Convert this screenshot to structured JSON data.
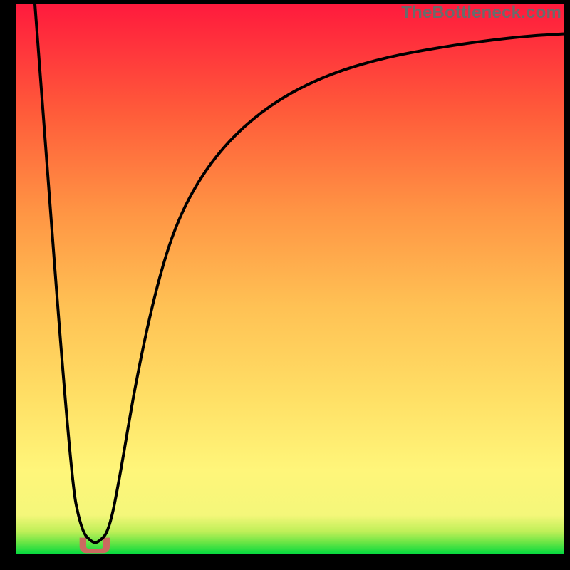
{
  "watermark": "TheBottleneck.com",
  "chart_data": {
    "type": "line",
    "title": "",
    "xlabel": "",
    "ylabel": "",
    "xlim": [
      0,
      100
    ],
    "ylim": [
      0,
      100
    ],
    "grid": false,
    "legend": false,
    "background_gradient_stops": [
      {
        "pct": 0,
        "color": "#08da3f"
      },
      {
        "pct": 2,
        "color": "#69e545"
      },
      {
        "pct": 4,
        "color": "#beef58"
      },
      {
        "pct": 7,
        "color": "#f4f77a"
      },
      {
        "pct": 15,
        "color": "#fff67a"
      },
      {
        "pct": 28,
        "color": "#ffe066"
      },
      {
        "pct": 45,
        "color": "#ffc154"
      },
      {
        "pct": 62,
        "color": "#ff9544"
      },
      {
        "pct": 80,
        "color": "#ff5c3a"
      },
      {
        "pct": 100,
        "color": "#ff1a3d"
      }
    ],
    "series": [
      {
        "name": "bottleneck-curve",
        "color": "#000000",
        "stroke_width": 4,
        "x": [
          3.5,
          10,
          12,
          14,
          15,
          17,
          19,
          22,
          26,
          30,
          36,
          44,
          54,
          66,
          80,
          92,
          100
        ],
        "y": [
          100,
          14,
          4,
          2,
          2,
          4,
          14,
          32,
          50,
          62,
          72,
          80,
          86,
          90,
          92.5,
          94,
          94.5
        ]
      }
    ],
    "markers": [
      {
        "name": "notch-marker",
        "shape": "rounded-u",
        "x_center": 14.4,
        "y_center": 1.5,
        "width": 5.5,
        "height": 2.8,
        "fill": "#cb6a60"
      }
    ]
  }
}
